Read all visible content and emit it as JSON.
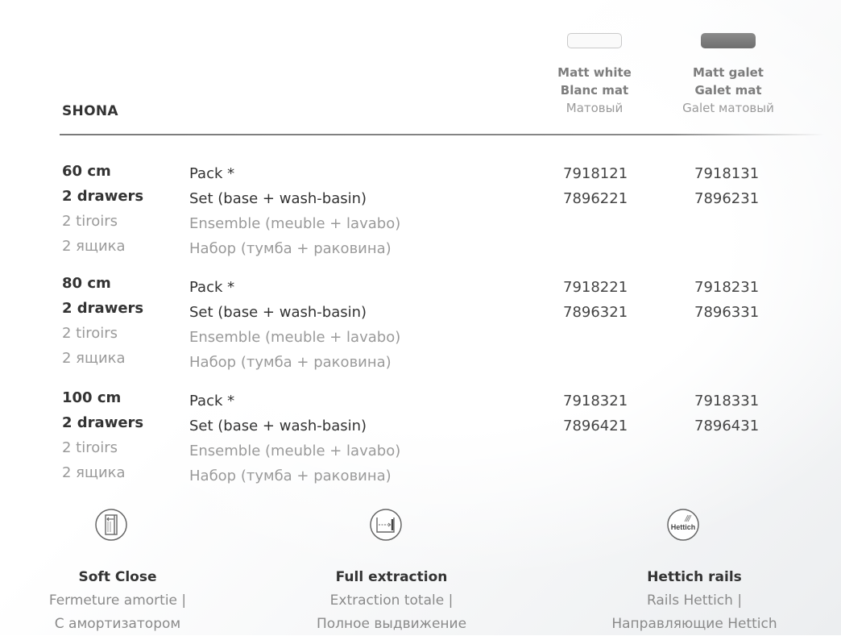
{
  "product": "SHONA",
  "columns": [
    {
      "swatch": "white",
      "swatch_color": "#fafafa",
      "en": "Matt white",
      "fr": "Blanc mat",
      "ru": "Матовый"
    },
    {
      "swatch": "galet",
      "swatch_color": "#7c7c7c",
      "en": "Matt galet",
      "fr": "Galet mat",
      "ru": "Galet матовый"
    }
  ],
  "rows": [
    {
      "size": "60 cm",
      "drawers_en": "2 drawers",
      "drawers_fr": "2 tiroirs",
      "drawers_ru": "2 ящика",
      "items": [
        "Pack *",
        "Set (base + wash-basin)",
        "Ensemble (meuble + lavabo)",
        "Набор (тумба + раковина)"
      ],
      "codes": [
        [
          "7918121",
          "7918131"
        ],
        [
          "7896221",
          "7896231"
        ]
      ]
    },
    {
      "size": "80 cm",
      "drawers_en": "2 drawers",
      "drawers_fr": "2 tiroirs",
      "drawers_ru": "2 ящика",
      "items": [
        "Pack *",
        "Set (base + wash-basin)",
        "Ensemble (meuble + lavabo)",
        "Набор (тумба + раковина)"
      ],
      "codes": [
        [
          "7918221",
          "7918231"
        ],
        [
          "7896321",
          "7896331"
        ]
      ]
    },
    {
      "size": "100 cm",
      "drawers_en": "2 drawers",
      "drawers_fr": "2 tiroirs",
      "drawers_ru": "2 ящика",
      "items": [
        "Pack *",
        "Set (base + wash-basin)",
        "Ensemble (meuble + lavabo)",
        "Набор (тумба + раковина)"
      ],
      "codes": [
        [
          "7918321",
          "7918331"
        ],
        [
          "7896421",
          "7896431"
        ]
      ]
    }
  ],
  "features": [
    {
      "icon": "soft-close-icon",
      "title": "Soft Close",
      "line1": "Fermeture amortie |",
      "line2": "С амортизатором"
    },
    {
      "icon": "full-extraction-icon",
      "title": "Full extraction",
      "line1": "Extraction totale |",
      "line2": "Полное выдвижение"
    },
    {
      "icon": "hettich-logo-icon",
      "logo_text": "Hettich",
      "title": "Hettich rails",
      "line1": "Rails Hettich |",
      "line2": "Направляющие Hettich"
    }
  ]
}
